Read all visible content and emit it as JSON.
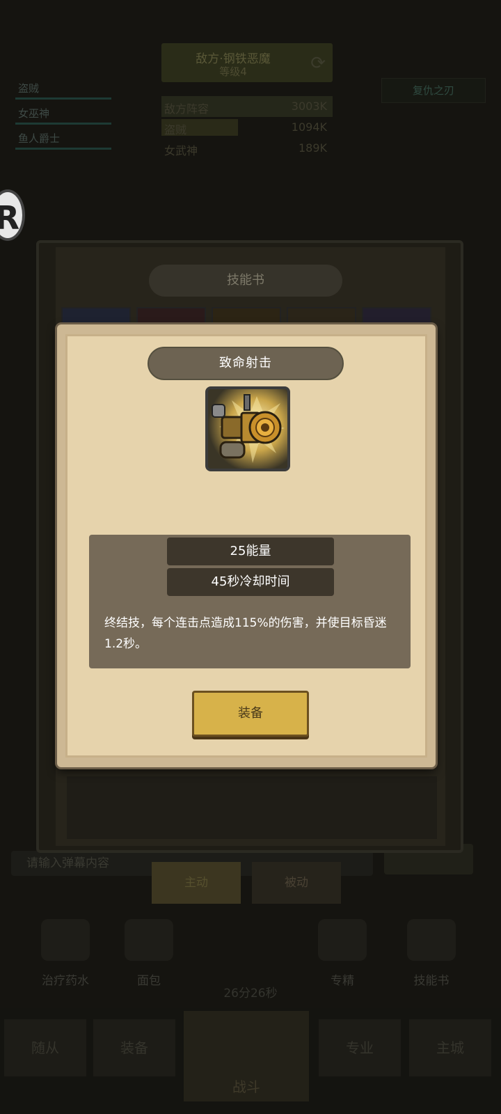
{
  "background": {
    "top_banner": {
      "title": "敌方·钢铁恶魔",
      "level": "等级4"
    },
    "party": [
      "盗贼",
      "女巫神",
      "鱼人爵士"
    ],
    "stats": [
      {
        "label": "敌方阵容",
        "value": "3003K"
      },
      {
        "label": "盗贼",
        "value": "1094K"
      },
      {
        "label": "女武神",
        "value": "189K"
      }
    ],
    "right_button": "复仇之刃",
    "search_placeholder": "请输入弹幕内容",
    "mode_tabs": [
      "主动",
      "被动"
    ],
    "items": [
      "治疗药水",
      "面包",
      "专精",
      "技能书"
    ],
    "timer": "26分26秒",
    "nav": [
      "随从",
      "装备",
      "战斗",
      "专业",
      "主城"
    ],
    "logo_letter": "R"
  },
  "skill_book": {
    "title": "技能书"
  },
  "modal": {
    "skill_name": "致命射击",
    "skill_icon": "cannon-icon",
    "energy": "25能量",
    "cooldown": "45秒冷却时间",
    "description": "终结技，每个连击点造成115%的伤害，并使目标昏迷1.2秒。",
    "equip_label": "装备"
  },
  "colors": {
    "modal_parchment": "#e6d3ac",
    "title_pill": "#6d6352",
    "info_box": "#766a58",
    "dark_pill": "#3d362b",
    "equip_button": "#d7b24a"
  }
}
